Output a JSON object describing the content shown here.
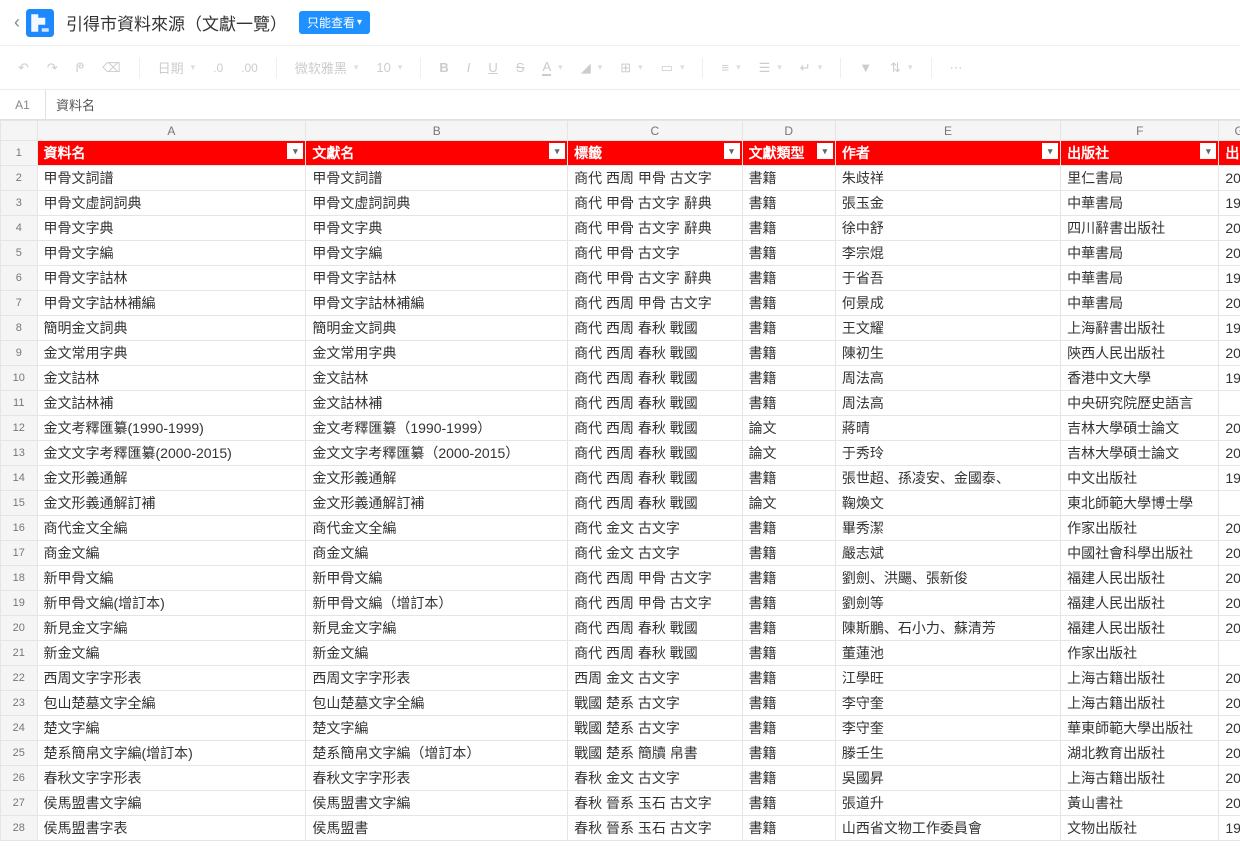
{
  "header": {
    "title": "引得市資料來源（文獻一覽）",
    "view_badge": "只能查看"
  },
  "toolbar": {
    "date": "日期",
    "dec_dec": ".0",
    "dec_inc": ".00",
    "font": "微软雅黑",
    "font_size": "10"
  },
  "formula": {
    "name_box": "A1",
    "value": "資料名"
  },
  "columns": [
    "A",
    "B",
    "C",
    "D",
    "E",
    "F",
    "G"
  ],
  "headers": {
    "A": "資料名",
    "B": "文獻名",
    "C": "標籤",
    "D": "文獻類型",
    "E": "作者",
    "F": "出版社",
    "G": "出"
  },
  "rows": [
    {
      "n": 2,
      "A": "甲骨文詞譜",
      "B": "甲骨文詞譜",
      "C": "商代 西周 甲骨 古文字",
      "D": "書籍",
      "E": "朱歧祥",
      "F": "里仁書局",
      "G": "20"
    },
    {
      "n": 3,
      "A": "甲骨文虛詞詞典",
      "B": "甲骨文虛詞詞典",
      "C": "商代 甲骨 古文字 辭典",
      "D": "書籍",
      "E": "張玉金",
      "F": "中華書局",
      "G": "19"
    },
    {
      "n": 4,
      "A": "甲骨文字典",
      "B": "甲骨文字典",
      "C": "商代 甲骨 古文字 辭典",
      "D": "書籍",
      "E": "徐中舒",
      "F": "四川辭書出版社",
      "G": "20"
    },
    {
      "n": 5,
      "A": "甲骨文字編",
      "B": "甲骨文字編",
      "C": "商代 甲骨 古文字",
      "D": "書籍",
      "E": "李宗焜",
      "F": "中華書局",
      "G": "20"
    },
    {
      "n": 6,
      "A": "甲骨文字詁林",
      "B": "甲骨文字詁林",
      "C": "商代 甲骨 古文字 辭典",
      "D": "書籍",
      "E": "于省吾",
      "F": "中華書局",
      "G": "19"
    },
    {
      "n": 7,
      "A": "甲骨文字詁林補編",
      "B": "甲骨文字詁林補編",
      "C": "商代 西周 甲骨 古文字",
      "D": "書籍",
      "E": "何景成",
      "F": "中華書局",
      "G": "20"
    },
    {
      "n": 8,
      "A": "簡明金文詞典",
      "B": "簡明金文詞典",
      "C": "商代 西周 春秋 戰國",
      "D": "書籍",
      "E": "王文耀",
      "F": "上海辭書出版社",
      "G": "19"
    },
    {
      "n": 9,
      "A": "金文常用字典",
      "B": "金文常用字典",
      "C": "商代 西周 春秋 戰國",
      "D": "書籍",
      "E": "陳初生",
      "F": "陝西人民出版社",
      "G": "20"
    },
    {
      "n": 10,
      "A": "金文詁林",
      "B": "金文詁林",
      "C": "商代 西周 春秋 戰國",
      "D": "書籍",
      "E": "周法高",
      "F": "香港中文大學",
      "G": "19"
    },
    {
      "n": 11,
      "A": "金文詁林補",
      "B": "金文詁林補",
      "C": "商代 西周 春秋 戰國",
      "D": "書籍",
      "E": "周法高",
      "F": "中央研究院歷史語言",
      "G": ""
    },
    {
      "n": 12,
      "A": "金文考釋匯纂(1990-1999)",
      "B": "金文考釋匯纂（1990-1999）",
      "C": "商代 西周 春秋 戰國",
      "D": "論文",
      "E": "蔣晴",
      "F": "吉林大學碩士論文",
      "G": "20"
    },
    {
      "n": 13,
      "A": "金文文字考釋匯纂(2000-2015)",
      "B": "金文文字考釋匯纂（2000-2015）",
      "C": "商代 西周 春秋 戰國",
      "D": "論文",
      "E": "于秀玲",
      "F": "吉林大學碩士論文",
      "G": "20"
    },
    {
      "n": 14,
      "A": "金文形義通解",
      "B": "金文形義通解",
      "C": "商代 西周 春秋 戰國",
      "D": "書籍",
      "E": "張世超、孫凌安、金國泰、",
      "F": "中文出版社",
      "G": "19"
    },
    {
      "n": 15,
      "A": "金文形義通解訂補",
      "B": "金文形義通解訂補",
      "C": "商代 西周 春秋 戰國",
      "D": "論文",
      "E": "鞠煥文",
      "F": "東北師範大學博士學",
      "G": ""
    },
    {
      "n": 16,
      "A": "商代金文全編",
      "B": "商代金文全編",
      "C": "商代 金文 古文字",
      "D": "書籍",
      "E": "畢秀潔",
      "F": "作家出版社",
      "G": "20"
    },
    {
      "n": 17,
      "A": "商金文編",
      "B": "商金文編",
      "C": "商代 金文 古文字",
      "D": "書籍",
      "E": "嚴志斌",
      "F": "中國社會科學出版社",
      "G": "20"
    },
    {
      "n": 18,
      "A": "新甲骨文編",
      "B": "新甲骨文編",
      "C": "商代 西周 甲骨 古文字",
      "D": "書籍",
      "E": "劉劍、洪颺、張新俊",
      "F": "福建人民出版社",
      "G": "20"
    },
    {
      "n": 19,
      "A": "新甲骨文編(增訂本)",
      "B": "新甲骨文編（增訂本）",
      "C": "商代 西周 甲骨 古文字",
      "D": "書籍",
      "E": "劉劍等",
      "F": "福建人民出版社",
      "G": "20"
    },
    {
      "n": 20,
      "A": "新見金文字編",
      "B": "新見金文字編",
      "C": "商代 西周 春秋 戰國",
      "D": "書籍",
      "E": "陳斯鵬、石小力、蘇清芳",
      "F": "福建人民出版社",
      "G": "20"
    },
    {
      "n": 21,
      "A": "新金文編",
      "B": "新金文編",
      "C": "商代 西周 春秋 戰國",
      "D": "書籍",
      "E": "董蓮池",
      "F": "作家出版社",
      "G": ""
    },
    {
      "n": 22,
      "A": "西周文字字形表",
      "B": "西周文字字形表",
      "C": "西周 金文 古文字",
      "D": "書籍",
      "E": "江學旺",
      "F": "上海古籍出版社",
      "G": "20"
    },
    {
      "n": 23,
      "A": "包山楚墓文字全編",
      "B": "包山楚墓文字全編",
      "C": "戰國 楚系 古文字",
      "D": "書籍",
      "E": "李守奎",
      "F": "上海古籍出版社",
      "G": "20"
    },
    {
      "n": 24,
      "A": "楚文字編",
      "B": "楚文字編",
      "C": "戰國 楚系 古文字",
      "D": "書籍",
      "E": "李守奎",
      "F": "華東師範大學出版社",
      "G": "20"
    },
    {
      "n": 25,
      "A": "楚系簡帛文字編(增訂本)",
      "B": "楚系簡帛文字編（增訂本）",
      "C": "戰國 楚系 簡牘 帛書",
      "D": "書籍",
      "E": "滕壬生",
      "F": "湖北教育出版社",
      "G": "20"
    },
    {
      "n": 26,
      "A": "春秋文字字形表",
      "B": "春秋文字字形表",
      "C": "春秋 金文 古文字",
      "D": "書籍",
      "E": "吳國昇",
      "F": "上海古籍出版社",
      "G": "20"
    },
    {
      "n": 27,
      "A": "侯馬盟書文字編",
      "B": "侯馬盟書文字編",
      "C": "春秋 晉系 玉石 古文字",
      "D": "書籍",
      "E": "張道升",
      "F": "黃山書社",
      "G": "20"
    },
    {
      "n": 28,
      "A": "侯馬盟書字表",
      "B": "侯馬盟書",
      "C": "春秋 晉系 玉石 古文字",
      "D": "書籍",
      "E": "山西省文物工作委員會",
      "F": "文物出版社",
      "G": "19"
    }
  ]
}
